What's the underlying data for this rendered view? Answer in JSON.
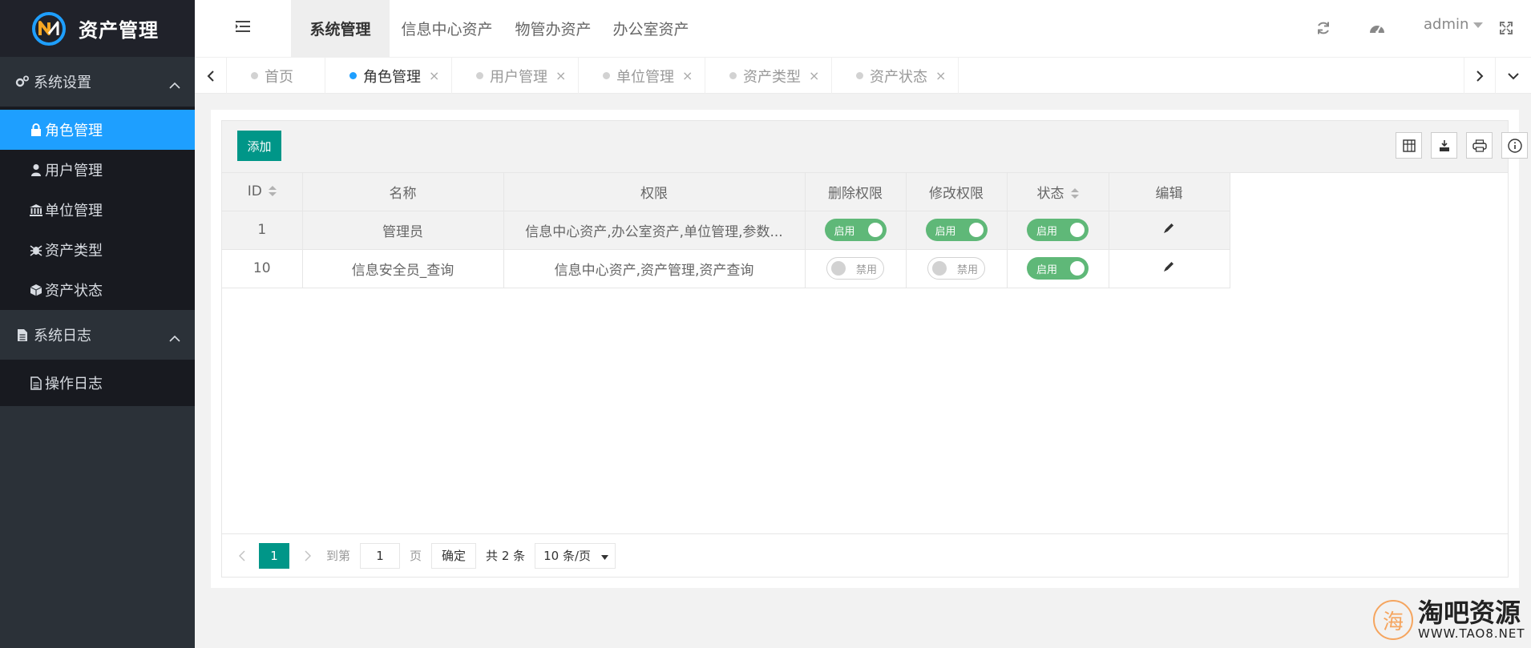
{
  "app": {
    "title": "资产管理"
  },
  "sidebar": {
    "groups": [
      {
        "label": "系统设置",
        "items": [
          {
            "label": "角色管理",
            "icon": "lock-icon",
            "active": true
          },
          {
            "label": "用户管理",
            "icon": "user-icon"
          },
          {
            "label": "单位管理",
            "icon": "institution-icon"
          },
          {
            "label": "资产类型",
            "icon": "bug-icon"
          },
          {
            "label": "资产状态",
            "icon": "cube-icon"
          }
        ]
      },
      {
        "label": "系统日志",
        "items": [
          {
            "label": "操作日志",
            "icon": "file-text-icon"
          }
        ]
      }
    ]
  },
  "header": {
    "tabs": [
      "系统管理",
      "信息中心资产",
      "物管办资产",
      "办公室资产"
    ],
    "active_tab": "系统管理",
    "user": "admin"
  },
  "page_tabs": [
    {
      "label": "首页",
      "closable": false
    },
    {
      "label": "角色管理",
      "closable": true,
      "active": true
    },
    {
      "label": "用户管理",
      "closable": true
    },
    {
      "label": "单位管理",
      "closable": true
    },
    {
      "label": "资产类型",
      "closable": true
    },
    {
      "label": "资产状态",
      "closable": true
    }
  ],
  "close_glyph": "×",
  "toolbar": {
    "add_label": "添加"
  },
  "table": {
    "columns": [
      "ID",
      "名称",
      "权限",
      "删除权限",
      "修改权限",
      "状态",
      "编辑"
    ],
    "rows": [
      {
        "id": "1",
        "name": "管理员",
        "perm": "信息中心资产,办公室资产,单位管理,参数...",
        "delete": "启用",
        "modify": "启用",
        "status": "启用"
      },
      {
        "id": "10",
        "name": "信息安全员_查询",
        "perm": "信息中心资产,资产管理,资产查询",
        "delete": "禁用",
        "modify": "禁用",
        "status": "启用"
      }
    ]
  },
  "pager": {
    "current": "1",
    "goto_label": "到第",
    "goto_value": "1",
    "page_label": "页",
    "confirm_label": "确定",
    "total_label": "共 2 条",
    "page_size": "10 条/页"
  },
  "watermark": {
    "circle": "海",
    "main": "淘吧资源",
    "sub": "WWW.TAO8.NET"
  },
  "colors": {
    "accent": "#009688",
    "active_blue": "#1e9fff",
    "switch_on": "#5fb878",
    "sidebar": "#2b3138"
  }
}
